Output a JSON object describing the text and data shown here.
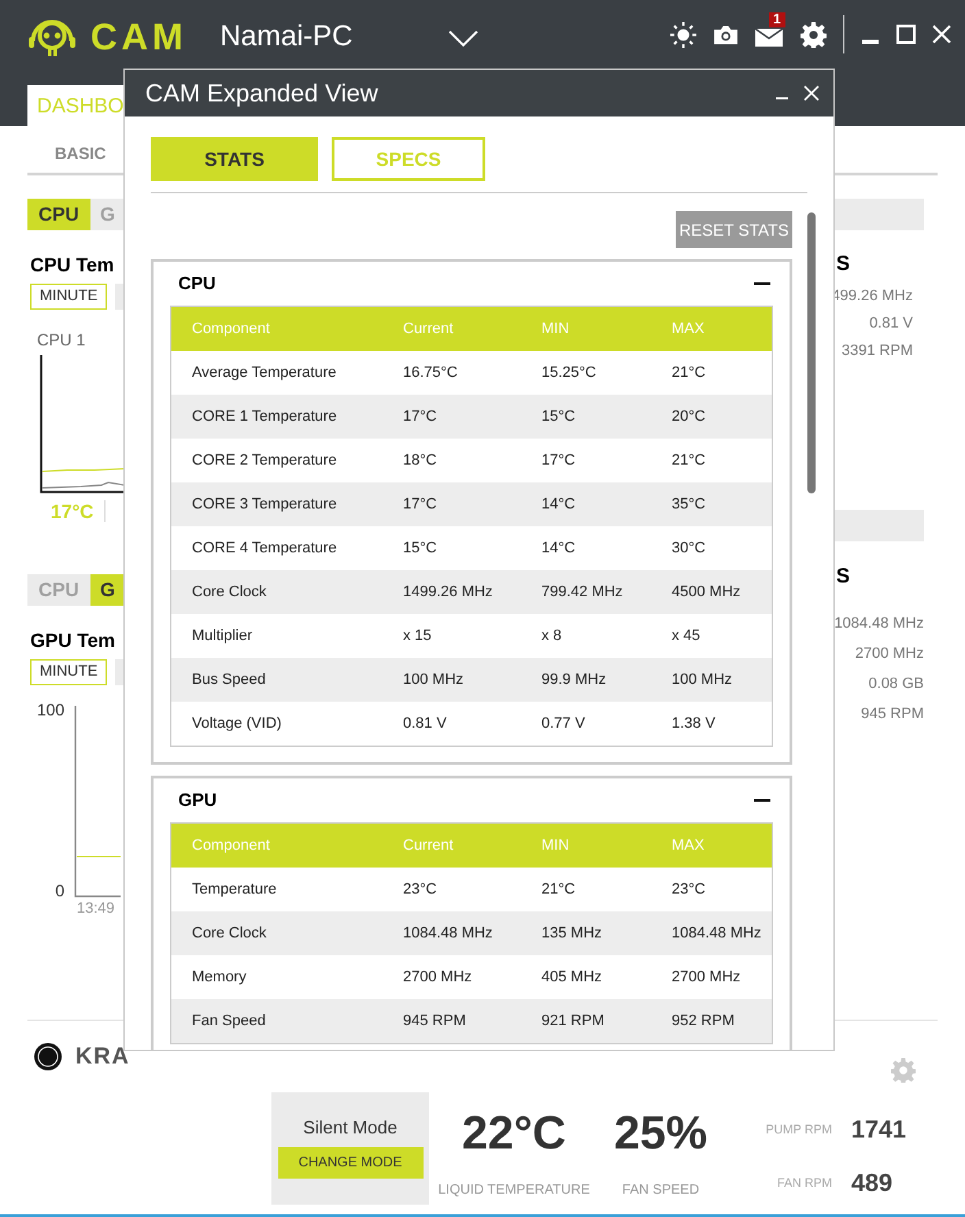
{
  "header": {
    "logo_text": "CAM",
    "pc_name": "Namai-PC",
    "notification_count": "1"
  },
  "main_tab": {
    "label": "DASHBO",
    "selected": true
  },
  "sub_tab": {
    "label": "BASIC"
  },
  "cpu_panel": {
    "tabs": [
      {
        "label": "CPU",
        "selected": true
      },
      {
        "label": "G",
        "selected": false
      }
    ],
    "title": "CPU Tem",
    "range_buttons": [
      {
        "label": "MINUTE",
        "selected": true
      },
      {
        "selected": false
      }
    ],
    "chart_label": "CPU 1",
    "reading": "17°C",
    "side_heading": "S",
    "side_values": [
      "499.26 MHz",
      "0.81 V",
      "3391 RPM"
    ]
  },
  "gpu_panel": {
    "tabs": [
      {
        "label": "CPU",
        "selected": false
      },
      {
        "label": "G",
        "selected": true
      }
    ],
    "title": "GPU Tem",
    "range_buttons": [
      {
        "label": "MINUTE",
        "selected": true
      },
      {
        "selected": false
      }
    ],
    "y_ticks": [
      "100",
      "0"
    ],
    "x_label": "13:49",
    "side_heading": "S",
    "side_values": [
      "1084.48 MHz",
      "2700 MHz",
      "0.08 GB",
      "945 RPM"
    ]
  },
  "kraken": {
    "name": "KRA",
    "mode": "Silent Mode",
    "mode_button": "CHANGE MODE",
    "liquid_temperature": "22°C",
    "liquid_label": "LIQUID TEMPERATURE",
    "fan_speed": "25%",
    "fan_label": "FAN SPEED",
    "stats": [
      {
        "label": "PUMP RPM",
        "value": "1741"
      },
      {
        "label": "FAN RPM",
        "value": "489"
      }
    ]
  },
  "expanded_view": {
    "title": "CAM Expanded View",
    "tabs": [
      {
        "label": "STATS",
        "selected": true
      },
      {
        "label": "SPECS",
        "selected": false
      }
    ],
    "reset_button": "RESET STATS",
    "sections": [
      {
        "title": "CPU",
        "expanded": true,
        "columns": [
          "Component",
          "Current",
          "MIN",
          "MAX"
        ],
        "rows": [
          [
            "Average Temperature",
            "16.75°C",
            "15.25°C",
            "21°C"
          ],
          [
            "CORE 1 Temperature",
            "17°C",
            "15°C",
            "20°C"
          ],
          [
            "CORE 2 Temperature",
            "18°C",
            "17°C",
            "21°C"
          ],
          [
            "CORE 3 Temperature",
            "17°C",
            "14°C",
            "35°C"
          ],
          [
            "CORE 4 Temperature",
            "15°C",
            "14°C",
            "30°C"
          ],
          [
            "Core Clock",
            "1499.26 MHz",
            "799.42 MHz",
            "4500 MHz"
          ],
          [
            "Multiplier",
            "x 15",
            "x 8",
            "x 45"
          ],
          [
            "Bus Speed",
            "100 MHz",
            "99.9 MHz",
            "100 MHz"
          ],
          [
            "Voltage (VID)",
            "0.81 V",
            "0.77 V",
            "1.38 V"
          ]
        ]
      },
      {
        "title": "GPU",
        "expanded": true,
        "columns": [
          "Component",
          "Current",
          "MIN",
          "MAX"
        ],
        "rows": [
          [
            "Temperature",
            "23°C",
            "21°C",
            "23°C"
          ],
          [
            "Core Clock",
            "1084.48 MHz",
            "135 MHz",
            "1084.48 MHz"
          ],
          [
            "Memory",
            "2700 MHz",
            "405 MHz",
            "2700 MHz"
          ],
          [
            "Fan Speed",
            "945 RPM",
            "921 RPM",
            "952 RPM"
          ]
        ]
      }
    ]
  }
}
